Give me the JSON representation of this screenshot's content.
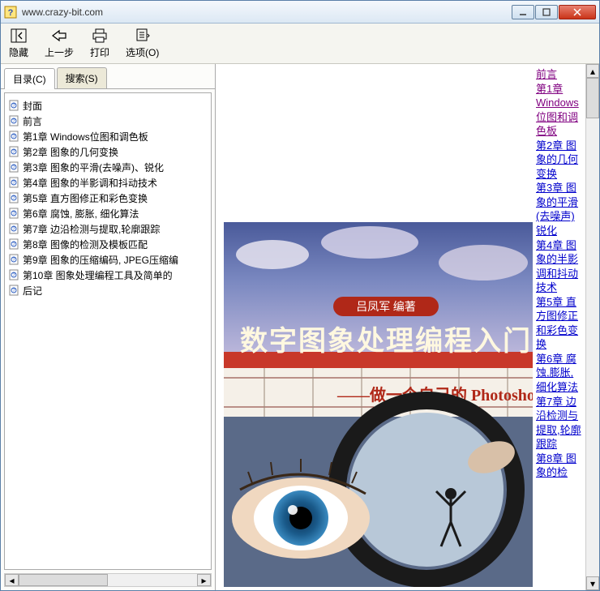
{
  "window": {
    "title": "www.crazy-bit.com"
  },
  "toolbar": {
    "hide": "隐藏",
    "back": "上一步",
    "print": "打印",
    "options": "选项(O)"
  },
  "tabs": {
    "contents": "目录(C)",
    "search": "搜索(S)"
  },
  "tree": [
    "封面",
    "前言",
    "第1章  Windows位图和调色板",
    "第2章  图象的几何变换",
    "第3章  图象的平滑(去噪声)、锐化",
    "第4章  图象的半影调和抖动技术",
    "第5章  直方图修正和彩色变换",
    "第6章  腐蚀, 膨胀, 细化算法",
    "第7章  边沿检测与提取,轮廓跟踪",
    "第8章  图像的检测及模板匹配",
    "第9章  图象的压缩编码, JPEG压缩编",
    "第10章  图象处理编程工具及简单的",
    "后记"
  ],
  "nav": [
    {
      "text": "前言",
      "visited": true
    },
    {
      "text": "第1章",
      "visited": true
    },
    {
      "text": "Windows位图和调色板",
      "visited": true
    },
    {
      "text": "第2章 图象的几何变换",
      "visited": false
    },
    {
      "text": "第3章 图象的平滑(去噪声)锐化",
      "visited": false
    },
    {
      "text": "第4章 图象的半影调和抖动技术",
      "visited": false
    },
    {
      "text": "第5章 直方图修正和彩色变换",
      "visited": false
    },
    {
      "text": "第6章 腐蚀,膨胀,细化算法",
      "visited": false
    },
    {
      "text": "第7章 边沿检测与提取,轮廓跟踪",
      "visited": false
    },
    {
      "text": "第8章 图象的检",
      "visited": false
    }
  ],
  "cover": {
    "author": "吕凤军  编著",
    "title": "数字图象处理编程入门",
    "subtitle": "——做一个自己的 Photoshop"
  }
}
